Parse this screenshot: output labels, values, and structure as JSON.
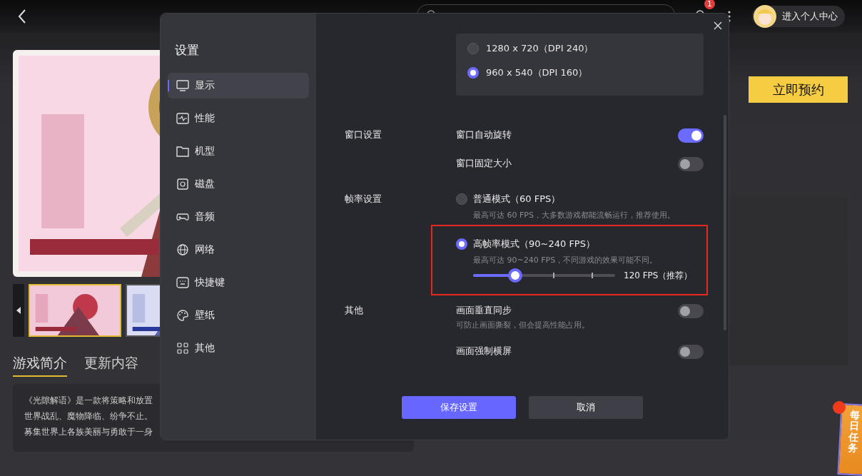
{
  "top_bar": {
    "notification_badge": "1",
    "profile": {
      "label": "进入个人中心"
    }
  },
  "game": {
    "thumbnails": [
      {
        "selected": true
      },
      {
        "selected": false
      }
    ],
    "tabs": [
      {
        "label": "游戏简介",
        "selected": true
      },
      {
        "label": "更新内容",
        "selected": false
      }
    ],
    "description": [
      "《光隙解语》是一款将策略和放置",
      "世界战乱、魔物降临、纷争不止。",
      "募集世界上各族美丽与勇敢于一身"
    ],
    "reserve_button": "立即预约",
    "daily_task": "每日任务"
  },
  "dialog": {
    "title": "设置",
    "nav": [
      {
        "label": "显示",
        "selected": true
      },
      {
        "label": "性能",
        "selected": false
      },
      {
        "label": "机型",
        "selected": false
      },
      {
        "label": "磁盘",
        "selected": false
      },
      {
        "label": "音频",
        "selected": false
      },
      {
        "label": "网络",
        "selected": false
      },
      {
        "label": "快捷键",
        "selected": false
      },
      {
        "label": "壁纸",
        "selected": false
      },
      {
        "label": "其他",
        "selected": false
      }
    ],
    "resolutions": [
      {
        "label": "1280 x 720（DPI 240）",
        "selected": false
      },
      {
        "label": "960 x 540（DPI 160）",
        "selected": true
      }
    ],
    "sections": [
      {
        "label": "窗口设置",
        "items": [
          {
            "kind": "toggle",
            "label": "窗口自动旋转",
            "on": true
          },
          {
            "kind": "toggle",
            "label": "窗口固定大小",
            "on": false
          }
        ]
      },
      {
        "label": "帧率设置",
        "items": [
          {
            "kind": "radio",
            "label": "普通模式（60 FPS）",
            "description": "最高可达 60 FPS，大多数游戏都能流畅运行，推荐使用。",
            "selected": false,
            "highlighted": false
          },
          {
            "kind": "radio",
            "label": "高帧率模式（90~240 FPS）",
            "description": "最高可达 90~240 FPS，不同游戏的效果可能不同。",
            "selected": true,
            "highlighted": true,
            "slider": {
              "level": 0.27,
              "reading": "120 FPS（推荐）"
            }
          }
        ]
      },
      {
        "label": "其他",
        "items": [
          {
            "kind": "toggle",
            "label": "画面垂直同步",
            "description": "可防止画面撕裂，但会提高性能占用。",
            "on": false
          },
          {
            "kind": "toggle",
            "label": "画面强制横屏",
            "on": false
          }
        ]
      }
    ],
    "buttons": [
      {
        "label": "保存设置",
        "kind": "primary"
      },
      {
        "label": "取消",
        "kind": "secondary"
      }
    ]
  }
}
